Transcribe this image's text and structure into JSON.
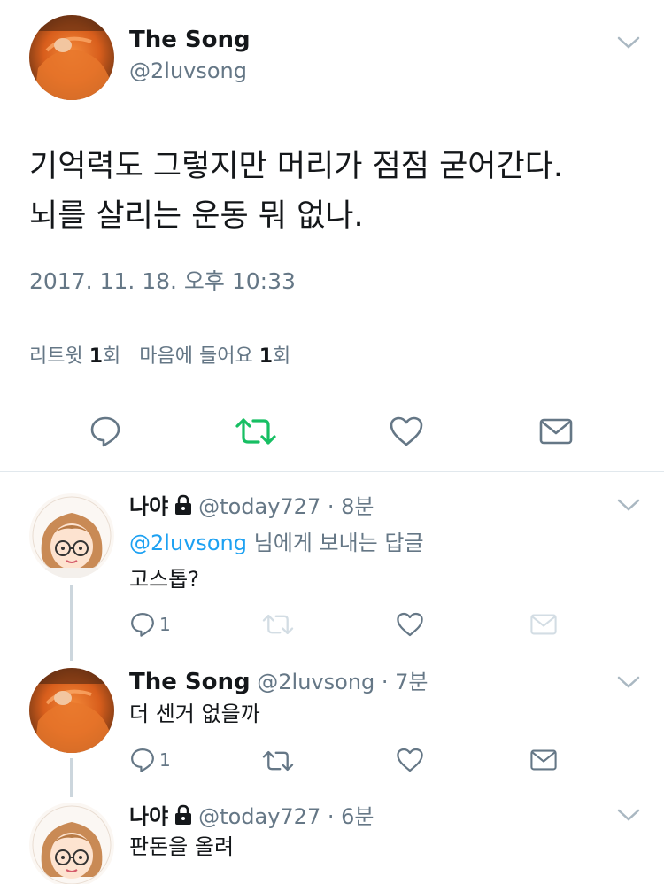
{
  "main_tweet": {
    "name": "The Song",
    "handle": "@2luvsong",
    "text_line1": "기억력도 그렇지만 머리가 점점 굳어간다.",
    "text_line2": "뇌를 살리는 운동 뭐 없나.",
    "timestamp": "2017. 11. 18. 오후 10:33",
    "retweet_label": "리트윗",
    "retweet_count": "1",
    "retweet_unit": "회",
    "like_label": "마음에 들어요",
    "like_count": "1",
    "like_unit": "회",
    "colors": {
      "retweet_active": "#17bf63",
      "icon": "#657786"
    }
  },
  "replies": [
    {
      "name": "나야",
      "handle": "@today727",
      "time": "· 8분",
      "reply_to_handle": "@2luvsong",
      "reply_to_suffix": "님에게 보내는 답글",
      "text": "고스톱?",
      "reply_count": "1",
      "locked": true
    },
    {
      "name": "The Song",
      "handle": "@2luvsong",
      "time": "· 7분",
      "text": "더 센거 없을까",
      "reply_count": "1",
      "locked": false
    },
    {
      "name": "나야",
      "handle": "@today727",
      "time": "· 6분",
      "text": "판돈을 올려",
      "locked": true
    }
  ]
}
